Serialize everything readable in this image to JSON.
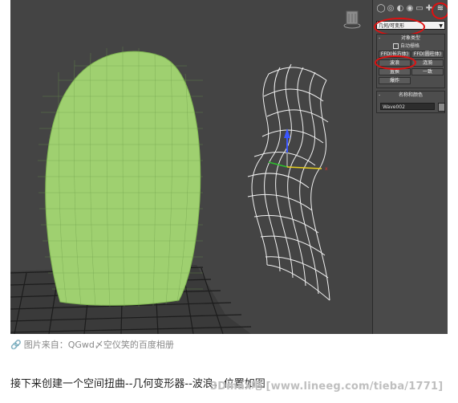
{
  "command_panel": {
    "tab_icons": [
      "sphere-create-icon",
      "shapes-icon",
      "lights-icon",
      "cameras-icon",
      "helpers-icon",
      "systems-icon",
      "space-warps-icon"
    ],
    "dropdown_value": "几何/可变形",
    "object_type": {
      "title": "对象类型",
      "auto_grid": "自动栅格",
      "buttons": [
        "FFD(长方体)",
        "FFD(圆柱体)",
        "波浪",
        "涟漪",
        "置换",
        "一致",
        "爆炸"
      ]
    },
    "name_color": {
      "title": "名称和颜色",
      "name_value": "Wave002"
    },
    "highlight_color": "#e01010"
  },
  "caption": {
    "prefix": "图片来自：",
    "author": "QGwd〆空仪笑的百度相册"
  },
  "body_text": "接下来创建一个空间扭曲--几何变形器--波浪，位置如图",
  "watermark": "3Dmax吧 [www.lineeg.com/tieba/1771]",
  "colors": {
    "viewport_bg": "#444444",
    "mesh_green": "#9acd6a",
    "wireframe": "#f2f2f2",
    "grid": "#1a1a1a"
  }
}
